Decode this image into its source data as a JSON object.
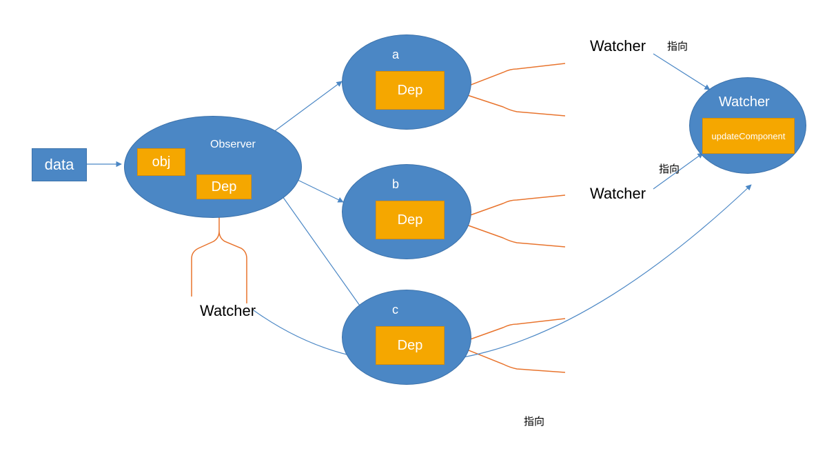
{
  "data_box": "data",
  "observer": {
    "title": "Observer",
    "obj": "obj",
    "dep": "Dep"
  },
  "prop_nodes": {
    "a": {
      "name": "a",
      "dep": "Dep"
    },
    "b": {
      "name": "b",
      "dep": "Dep"
    },
    "c": {
      "name": "c",
      "dep": "Dep"
    }
  },
  "watcher_labels": {
    "below_observer": "Watcher",
    "top_right": "Watcher",
    "mid_right": "Watcher"
  },
  "watcher_node": {
    "title": "Watcher",
    "inner": "updateComponent"
  },
  "arrow_labels": {
    "top": "指向",
    "mid": "指向",
    "bottom": "指向"
  }
}
